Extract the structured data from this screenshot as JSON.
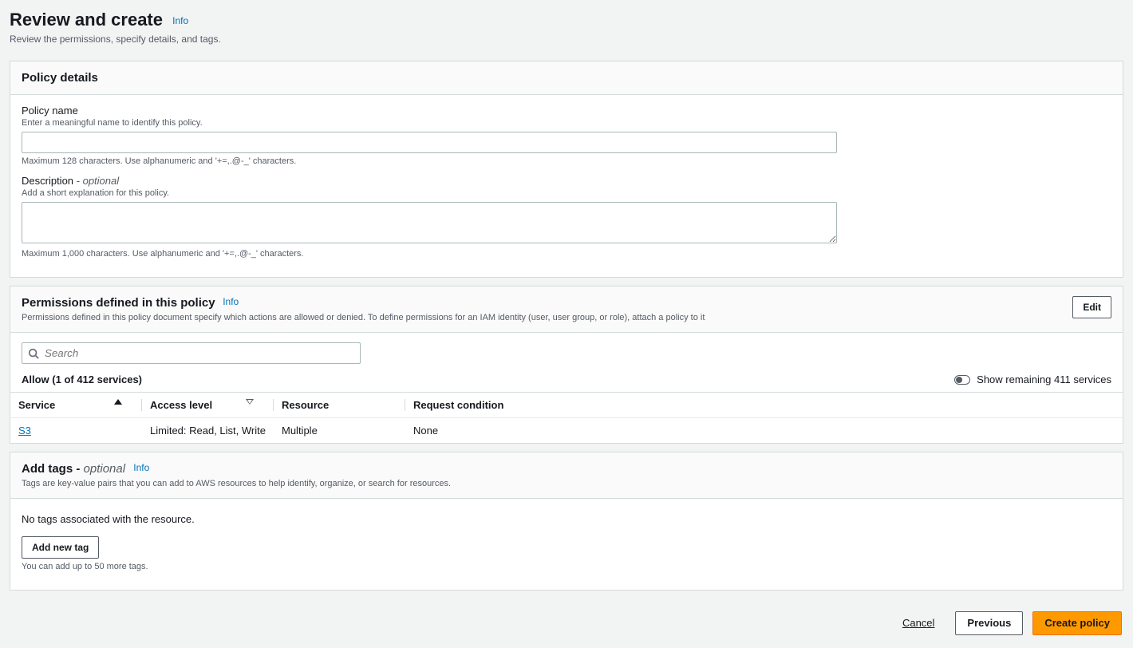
{
  "page": {
    "title": "Review and create",
    "info": "Info",
    "desc": "Review the permissions, specify details, and tags."
  },
  "policy_details": {
    "title": "Policy details",
    "name": {
      "label": "Policy name",
      "help": "Enter a meaningful name to identify this policy.",
      "value": "",
      "constraint": "Maximum 128 characters. Use alphanumeric and '+=,.@-_' characters."
    },
    "description": {
      "label": "Description",
      "optional": " - optional",
      "help": "Add a short explanation for this policy.",
      "value": "",
      "constraint": "Maximum 1,000 characters. Use alphanumeric and '+=,.@-_' characters."
    }
  },
  "permissions": {
    "title": "Permissions defined in this policy",
    "info": "Info",
    "edit": "Edit",
    "desc": "Permissions defined in this policy document specify which actions are allowed or denied. To define permissions for an IAM identity (user, user group, or role), attach a policy to it",
    "search_placeholder": "Search",
    "allow_summary": "Allow (1 of 412 services)",
    "toggle_label": "Show remaining 411 services",
    "columns": {
      "service": "Service",
      "access": "Access level",
      "resource": "Resource",
      "condition": "Request condition"
    },
    "rows": [
      {
        "service": "S3",
        "access": "Limited: Read, List, Write",
        "resource": "Multiple",
        "condition": "None"
      }
    ]
  },
  "tags": {
    "title": "Add tags -",
    "optional": " optional",
    "info": "Info",
    "desc": "Tags are key-value pairs that you can add to AWS resources to help identify, organize, or search for resources.",
    "empty": "No tags associated with the resource.",
    "add": "Add new tag",
    "limit": "You can add up to 50 more tags."
  },
  "footer": {
    "cancel": "Cancel",
    "previous": "Previous",
    "create": "Create policy"
  }
}
